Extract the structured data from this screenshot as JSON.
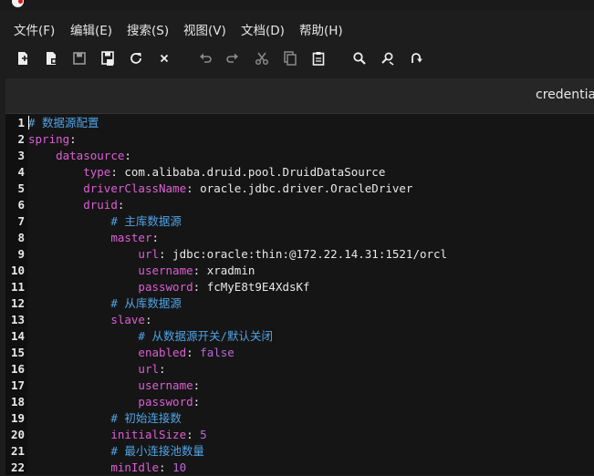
{
  "menu": [
    "文件(F)",
    "编辑(E)",
    "搜索(S)",
    "视图(V)",
    "文档(D)",
    "帮助(H)"
  ],
  "toolbar": [
    {
      "name": "new-file-icon"
    },
    {
      "name": "new-template-icon"
    },
    {
      "name": "save-icon"
    },
    {
      "name": "save-all-icon"
    },
    {
      "name": "reload-icon"
    },
    {
      "name": "close-icon"
    },
    {
      "name": "undo-icon"
    },
    {
      "name": "redo-icon"
    },
    {
      "name": "cut-icon"
    },
    {
      "name": "copy-icon"
    },
    {
      "name": "paste-icon"
    },
    {
      "name": "find-icon"
    },
    {
      "name": "find-replace-icon"
    },
    {
      "name": "jump-icon"
    }
  ],
  "tab": {
    "label": "credentials"
  },
  "editor": {
    "lines": [
      {
        "n": "1",
        "indent": "",
        "parts": [
          [
            "comment",
            "# 数据源配置"
          ]
        ]
      },
      {
        "n": "2",
        "indent": "",
        "parts": [
          [
            "key",
            "spring"
          ],
          [
            "val",
            ":"
          ]
        ]
      },
      {
        "n": "3",
        "indent": "    ",
        "parts": [
          [
            "key",
            "datasource"
          ],
          [
            "val",
            ":"
          ]
        ]
      },
      {
        "n": "4",
        "indent": "        ",
        "parts": [
          [
            "key",
            "type"
          ],
          [
            "val",
            ": com.alibaba.druid.pool.DruidDataSource"
          ]
        ]
      },
      {
        "n": "5",
        "indent": "        ",
        "parts": [
          [
            "key",
            "driverClassName"
          ],
          [
            "val",
            ": oracle.jdbc.driver.OracleDriver"
          ]
        ]
      },
      {
        "n": "6",
        "indent": "        ",
        "parts": [
          [
            "key",
            "druid"
          ],
          [
            "val",
            ":"
          ]
        ]
      },
      {
        "n": "7",
        "indent": "            ",
        "parts": [
          [
            "comment",
            "# 主库数据源"
          ]
        ]
      },
      {
        "n": "8",
        "indent": "            ",
        "parts": [
          [
            "key",
            "master"
          ],
          [
            "val",
            ":"
          ]
        ]
      },
      {
        "n": "9",
        "indent": "                ",
        "parts": [
          [
            "key",
            "url"
          ],
          [
            "val",
            ": jdbc:oracle:thin:@172.22.14.31:1521/orcl"
          ]
        ]
      },
      {
        "n": "10",
        "indent": "                ",
        "parts": [
          [
            "key",
            "username"
          ],
          [
            "val",
            ": xradmin"
          ]
        ]
      },
      {
        "n": "11",
        "indent": "                ",
        "parts": [
          [
            "key",
            "password"
          ],
          [
            "val",
            ": fcMyE8t9E4XdsKf"
          ]
        ]
      },
      {
        "n": "12",
        "indent": "            ",
        "parts": [
          [
            "comment",
            "# 从库数据源"
          ]
        ]
      },
      {
        "n": "13",
        "indent": "            ",
        "parts": [
          [
            "key",
            "slave"
          ],
          [
            "val",
            ":"
          ]
        ]
      },
      {
        "n": "14",
        "indent": "                ",
        "parts": [
          [
            "comment",
            "# 从数据源开关/默认关闭"
          ]
        ]
      },
      {
        "n": "15",
        "indent": "                ",
        "parts": [
          [
            "key",
            "enabled"
          ],
          [
            "val",
            ": "
          ],
          [
            "kw",
            "false"
          ]
        ]
      },
      {
        "n": "16",
        "indent": "                ",
        "parts": [
          [
            "key",
            "url"
          ],
          [
            "val",
            ":"
          ]
        ]
      },
      {
        "n": "17",
        "indent": "                ",
        "parts": [
          [
            "key",
            "username"
          ],
          [
            "val",
            ":"
          ]
        ]
      },
      {
        "n": "18",
        "indent": "                ",
        "parts": [
          [
            "key",
            "password"
          ],
          [
            "val",
            ":"
          ]
        ]
      },
      {
        "n": "19",
        "indent": "            ",
        "parts": [
          [
            "comment",
            "# 初始连接数"
          ]
        ]
      },
      {
        "n": "20",
        "indent": "            ",
        "parts": [
          [
            "key",
            "initialSize"
          ],
          [
            "val",
            ": "
          ],
          [
            "num",
            "5"
          ]
        ]
      },
      {
        "n": "21",
        "indent": "            ",
        "parts": [
          [
            "comment",
            "# 最小连接池数量"
          ]
        ]
      },
      {
        "n": "22",
        "indent": "            ",
        "parts": [
          [
            "key",
            "minIdle"
          ],
          [
            "val",
            ": "
          ],
          [
            "num",
            "10"
          ]
        ]
      }
    ]
  }
}
